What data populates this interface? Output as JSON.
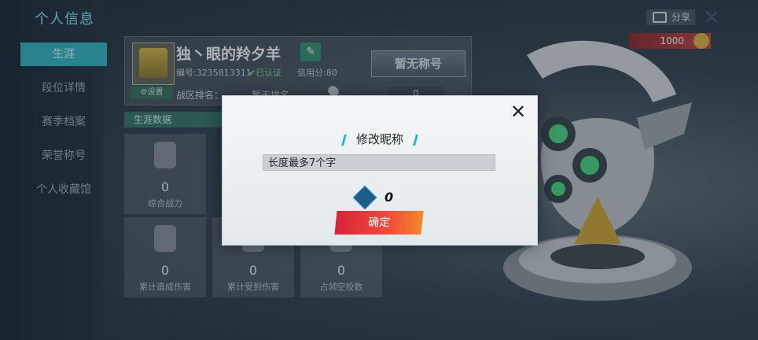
{
  "page_title": "个人信息",
  "sidebar": {
    "items": [
      {
        "label": "生涯",
        "active": true
      },
      {
        "label": "段位详情",
        "active": false
      },
      {
        "label": "赛季档案",
        "active": false
      },
      {
        "label": "荣誉称号",
        "active": false
      },
      {
        "label": "个人收藏馆",
        "active": false
      }
    ]
  },
  "profile": {
    "name": "独丶眼的羚夕羊",
    "id_text": "编号:3235813311",
    "verified": "✔已认证",
    "credit": "信用分:80",
    "settings": "⚙设置",
    "zone_rank_label": "战区排名：",
    "zone_rank_value": "暂无排名",
    "title_badge": "暂无称号",
    "title_sub_value": "0"
  },
  "career": {
    "section_label": "生涯数据",
    "stats": [
      {
        "value": "0",
        "label": "综合战力"
      },
      {
        "value": "0",
        "label": "累计造成伤害"
      },
      {
        "value": "0",
        "label": "累计受到伤害"
      },
      {
        "value": "0",
        "label": "占领空投数"
      }
    ]
  },
  "top_right": {
    "share": "分享",
    "currency": "1000"
  },
  "modal": {
    "title": "修改昵称",
    "input_placeholder": "长度最多7个字",
    "cost": "0",
    "confirm": "确定"
  },
  "colors": {
    "accent": "#2bb3be",
    "confirm_start": "#d8243a",
    "confirm_end": "#f3872d"
  }
}
